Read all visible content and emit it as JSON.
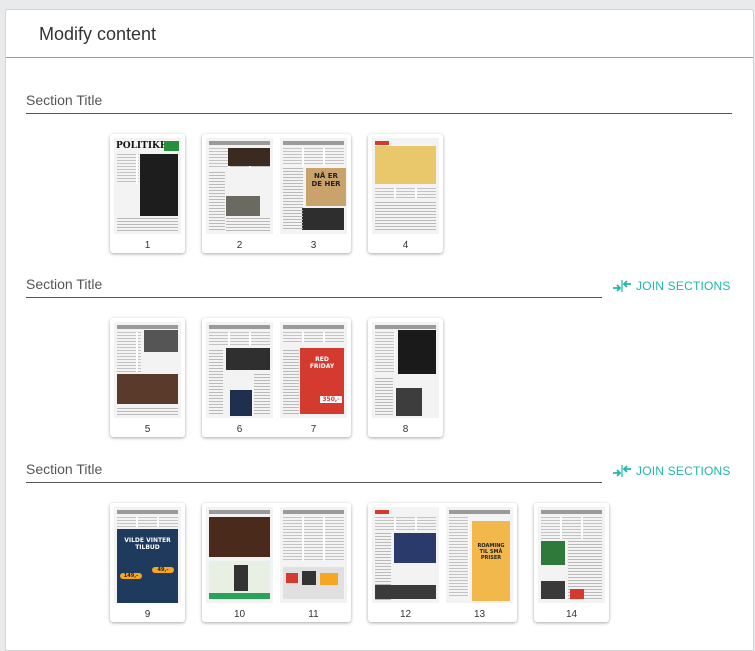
{
  "header": {
    "title": "Modify content"
  },
  "sections": [
    {
      "title": "Section Title",
      "join_label": null,
      "groups": [
        {
          "pages": [
            {
              "number": "1",
              "label": ""
            }
          ]
        },
        {
          "pages": [
            {
              "number": "2",
              "label": ""
            },
            {
              "number": "3",
              "label": ""
            }
          ]
        },
        {
          "pages": [
            {
              "number": "4",
              "label": ""
            }
          ]
        }
      ]
    },
    {
      "title": "Section Title",
      "join_label": "JOIN SECTIONS",
      "groups": [
        {
          "pages": [
            {
              "number": "5",
              "label": ""
            }
          ]
        },
        {
          "pages": [
            {
              "number": "6",
              "label": ""
            },
            {
              "number": "7",
              "label": ""
            }
          ]
        },
        {
          "pages": [
            {
              "number": "8",
              "label": ""
            }
          ]
        }
      ]
    },
    {
      "title": "Section Title",
      "join_label": "JOIN SECTIONS",
      "groups": [
        {
          "pages": [
            {
              "number": "9",
              "label": ""
            }
          ]
        },
        {
          "pages": [
            {
              "number": "10",
              "label": ""
            },
            {
              "number": "11",
              "label": ""
            }
          ]
        },
        {
          "pages": [
            {
              "number": "12",
              "label": ""
            },
            {
              "number": "13",
              "label": ""
            }
          ]
        },
        {
          "pages": [
            {
              "number": "14",
              "label": ""
            }
          ]
        }
      ]
    }
  ],
  "thumb_text": {
    "p1_masthead": "POLITIKEN",
    "p3_headline": "NÅ ER DE HER",
    "p7_headline": "RED FRIDAY",
    "p7_price": "350,-",
    "p9_headline": "VILDE VINTER TILBUD",
    "p9_price1": "149,-",
    "p9_price2": "49,-",
    "p13_headline": "ROAMING TIL SMÅ PRISER"
  },
  "colors": {
    "accent": "#1fb8aa",
    "text": "#333333",
    "line": "#555555"
  },
  "icons": {
    "join": "join-arrows-icon"
  }
}
